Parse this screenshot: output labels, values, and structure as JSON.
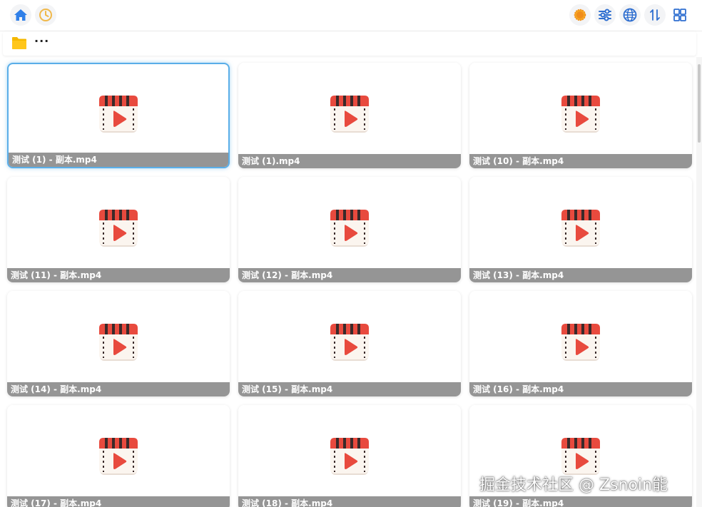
{
  "toolbar": {
    "left": [
      {
        "name": "home-icon",
        "color": "#2f7fe8"
      },
      {
        "name": "history-clock-icon",
        "color": "#f0b84a"
      }
    ],
    "right": [
      {
        "name": "theme-sun-icon",
        "color": "#f08c1a"
      },
      {
        "name": "filter-sliders-icon",
        "color": "#2f6fd0"
      },
      {
        "name": "globe-icon",
        "color": "#2f6fd0"
      },
      {
        "name": "sort-arrows-icon",
        "color": "#2f6fd0"
      },
      {
        "name": "grid-view-icon",
        "color": "#2f6fd0"
      }
    ]
  },
  "breadcrumb": {
    "folder_icon": "folder-icon",
    "folder_color": "#f5b800",
    "text": "···"
  },
  "files": [
    {
      "name": "测试 (1) - 副本.mp4",
      "selected": true
    },
    {
      "name": "测试 (1).mp4"
    },
    {
      "name": "测试 (10) - 副本.mp4"
    },
    {
      "name": "测试 (11) - 副本.mp4"
    },
    {
      "name": "测试 (12) - 副本.mp4"
    },
    {
      "name": "测试 (13) - 副本.mp4"
    },
    {
      "name": "测试 (14) - 副本.mp4"
    },
    {
      "name": "测试 (15) - 副本.mp4"
    },
    {
      "name": "测试 (16) - 副本.mp4"
    },
    {
      "name": "测试 (17) - 副本.mp4"
    },
    {
      "name": "测试 (18) - 副本.mp4"
    },
    {
      "name": "测试 (19) - 副本.mp4"
    }
  ],
  "file_icon": "video-file-icon",
  "watermark": "掘金技术社区 @ Zsnoin能"
}
